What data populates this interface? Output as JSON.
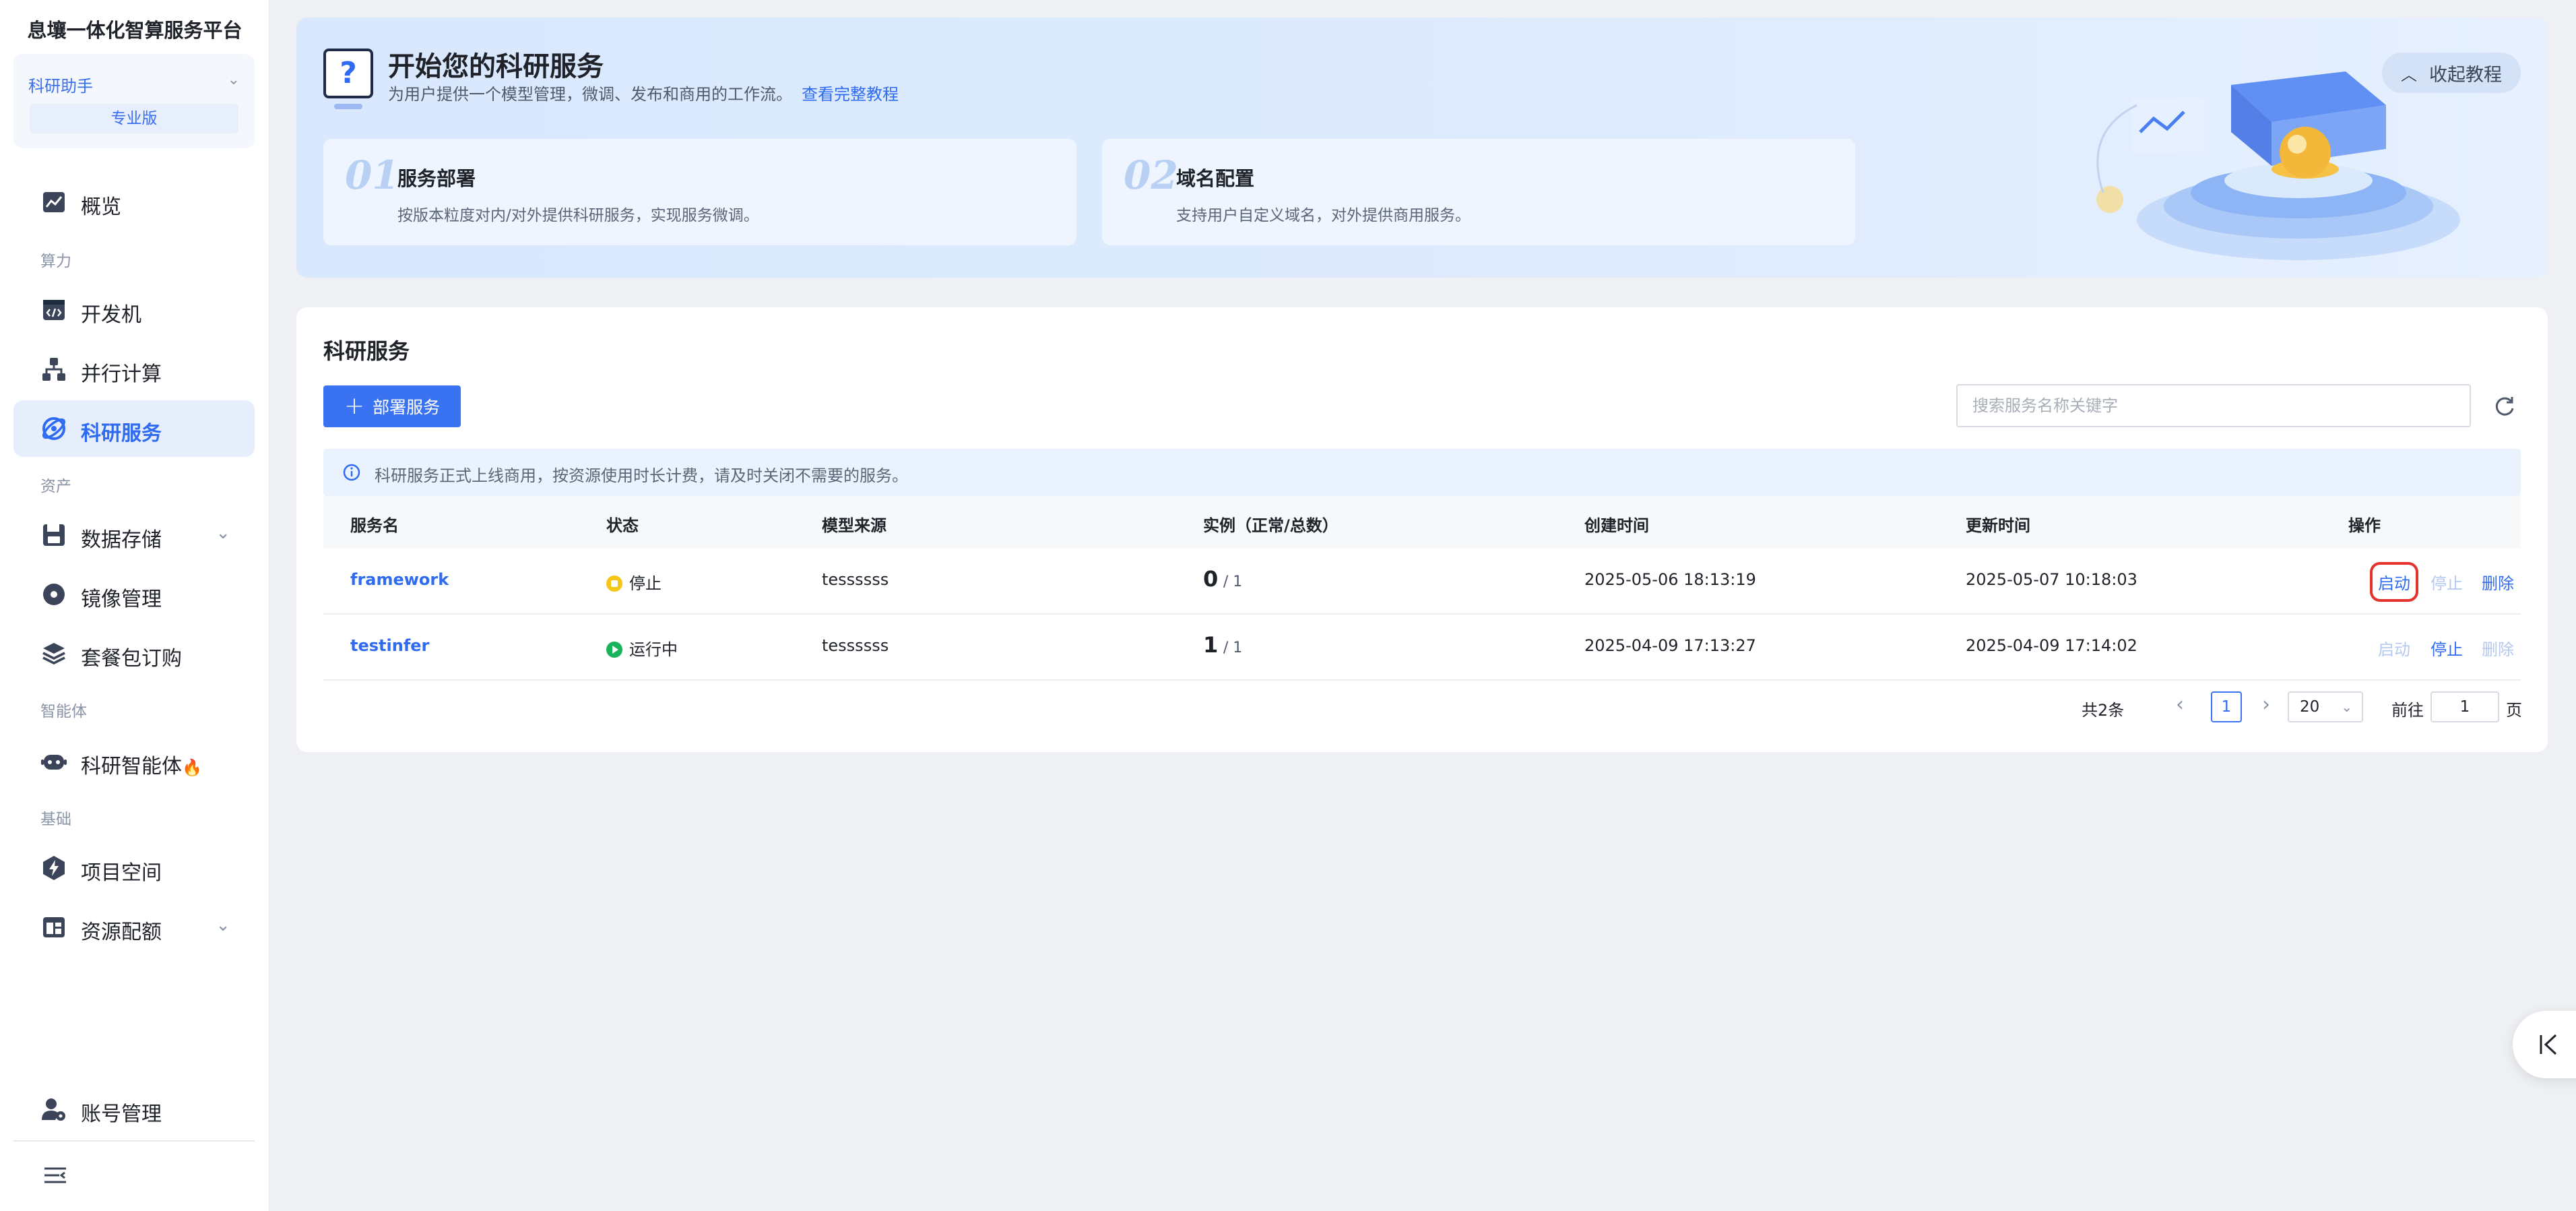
{
  "sidebar": {
    "platform_title": "息壤一体化智算服务平台",
    "assistant": {
      "name": "科研助手",
      "edition": "专业版"
    },
    "sections": {
      "compute": "算力",
      "assets": "资产",
      "agents": "智能体",
      "basic": "基础"
    },
    "items": {
      "overview": "概览",
      "devmachine": "开发机",
      "parallel": "并行计算",
      "research_service": "科研服务",
      "storage": "数据存储",
      "images": "镜像管理",
      "packages": "套餐包订购",
      "agent": "科研智能体",
      "project_space": "项目空间",
      "quota": "资源配额",
      "account": "账号管理"
    },
    "active_item": "科研服务",
    "fire_emoji": "🔥"
  },
  "banner": {
    "title": "开始您的科研服务",
    "subtitle": "为用户提供一个模型管理，微调、发布和商用的工作流。",
    "link": "查看完整教程",
    "collapse_label": "收起教程",
    "steps": [
      {
        "num": "01",
        "title": "服务部署",
        "desc": "按版本粒度对内/对外提供科研服务，实现服务微调。"
      },
      {
        "num": "02",
        "title": "域名配置",
        "desc": "支持用户自定义域名，对外提供商用服务。"
      }
    ]
  },
  "panel": {
    "title": "科研服务",
    "deploy_label": "部署服务",
    "search_placeholder": "搜索服务名称关键字",
    "notice": "科研服务正式上线商用，按资源使用时长计费，请及时关闭不需要的服务。",
    "columns": [
      "服务名",
      "状态",
      "模型来源",
      "实例（正常/总数）",
      "创建时间",
      "更新时间",
      "操作"
    ],
    "rows": [
      {
        "name": "framework",
        "status": "停止",
        "status_color": "#f5c518",
        "model_source": "tessssss",
        "instances_normal": "0",
        "instances_total": "/ 1",
        "created": "2025-05-06 18:13:19",
        "updated": "2025-05-07 10:18:03",
        "ops": {
          "start": "启动",
          "stop": "停止",
          "delete": "删除"
        }
      },
      {
        "name": "testinfer",
        "status": "运行中",
        "status_color": "#19b35a",
        "model_source": "tessssss",
        "instances_normal": "1",
        "instances_total": "/ 1",
        "created": "2025-04-09 17:13:27",
        "updated": "2025-04-09 17:14:02",
        "ops": {
          "start": "启动",
          "stop": "停止",
          "delete": "删除"
        }
      }
    ],
    "pagination": {
      "total": "共2条",
      "current_page": "1",
      "page_size": "20",
      "goto_prefix": "前往",
      "goto_value": "1",
      "goto_suffix": "页"
    }
  },
  "colors": {
    "accent": "#2f6bf0",
    "button": "#3a73f2",
    "highlight_box": "#e5322d",
    "sidebar_active_bg": "#e6eefc"
  }
}
